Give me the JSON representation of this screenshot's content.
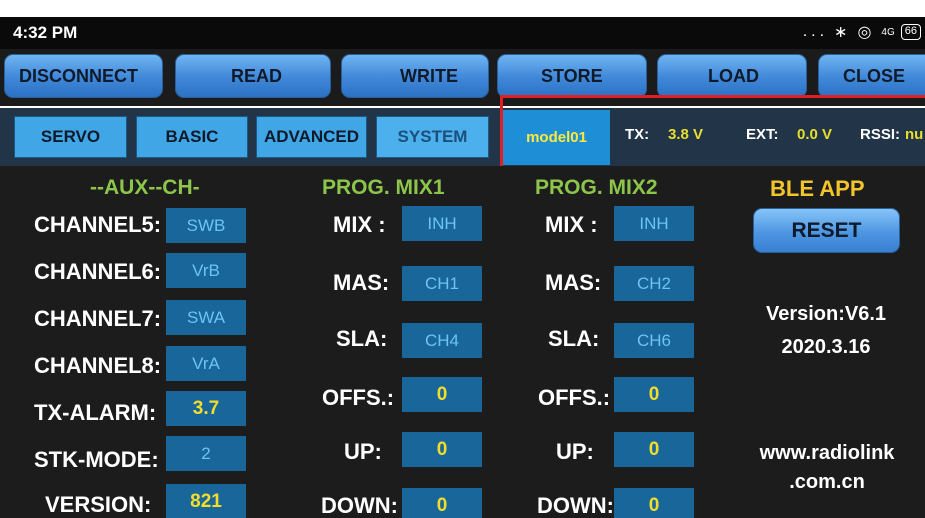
{
  "status_bar": {
    "time": "4:32 PM",
    "icons": [
      "more-dots-icon",
      "bluetooth-icon",
      "alarm-icon",
      "signal-icon"
    ],
    "more": "...",
    "bluetooth": "∗",
    "alarm": "◎",
    "signal": "4G",
    "battery": "66"
  },
  "toolbar": {
    "disconnect": "DISCONNECT",
    "read": "READ",
    "write": "WRITE",
    "store": "STORE",
    "load": "LOAD",
    "close": "CLOSE"
  },
  "tabs": {
    "servo": "SERVO",
    "basic": "BASIC",
    "advanced": "ADVANCED",
    "system": "SYSTEM"
  },
  "info": {
    "model": "model01",
    "tx_label": "TX:",
    "tx_value": "3.8 V",
    "ext_label": "EXT:",
    "ext_value": "0.0 V",
    "rssi_label": "RSSI:",
    "rssi_value": "nu"
  },
  "aux": {
    "header": "--AUX--CH-",
    "channel5_label": "CHANNEL5:",
    "channel5_value": "SWB",
    "channel6_label": "CHANNEL6:",
    "channel6_value": "VrB",
    "channel7_label": "CHANNEL7:",
    "channel7_value": "SWA",
    "channel8_label": "CHANNEL8:",
    "channel8_value": "VrA",
    "tx_alarm_label": "TX-ALARM:",
    "tx_alarm_value": "3.7",
    "stk_mode_label": "STK-MODE:",
    "stk_mode_value": "2",
    "version_label": "VERSION:",
    "version_value": "821"
  },
  "mix1": {
    "header": "PROG. MIX1",
    "mix_label": "MIX :",
    "mix_value": "INH",
    "mas_label": "MAS:",
    "mas_value": "CH1",
    "sla_label": "SLA:",
    "sla_value": "CH4",
    "offs_label": "OFFS.:",
    "offs_value": "0",
    "up_label": "UP:",
    "up_value": "0",
    "down_label": "DOWN:",
    "down_value": "0"
  },
  "mix2": {
    "header": "PROG. MIX2",
    "mix_label": "MIX :",
    "mix_value": "INH",
    "mas_label": "MAS:",
    "mas_value": "CH2",
    "sla_label": "SLA:",
    "sla_value": "CH6",
    "offs_label": "OFFS.:",
    "offs_value": "0",
    "up_label": "UP:",
    "up_value": "0",
    "down_label": "DOWN:",
    "down_value": "0"
  },
  "ble": {
    "header": "BLE APP",
    "reset": "RESET",
    "version": "Version:V6.1",
    "date": "2020.3.16",
    "url_line1": "www.radiolink",
    "url_line2": ".com.cn"
  },
  "colors": {
    "highlight_border": "#e11f22",
    "value_text": "#f3dd2a",
    "header_green": "#8bc64a",
    "header_gold": "#f2c52c"
  }
}
